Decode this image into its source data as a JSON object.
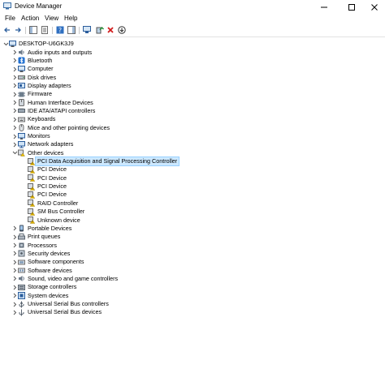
{
  "window": {
    "title": "Device Manager"
  },
  "menu": [
    "File",
    "Action",
    "View",
    "Help"
  ],
  "tree": {
    "root": "DESKTOP-U6GK3J9",
    "categories_before": [
      {
        "label": "Audio inputs and outputs",
        "icon": "speaker-icon"
      },
      {
        "label": "Bluetooth",
        "icon": "bluetooth-icon"
      },
      {
        "label": "Computer",
        "icon": "computer-icon"
      },
      {
        "label": "Disk drives",
        "icon": "disk-drive-icon"
      },
      {
        "label": "Display adapters",
        "icon": "display-adapter-icon"
      },
      {
        "label": "Firmware",
        "icon": "firmware-icon"
      },
      {
        "label": "Human Interface Devices",
        "icon": "hid-icon"
      },
      {
        "label": "IDE ATA/ATAPI controllers",
        "icon": "ide-controller-icon"
      },
      {
        "label": "Keyboards",
        "icon": "keyboard-icon"
      },
      {
        "label": "Mice and other pointing devices",
        "icon": "mouse-icon"
      },
      {
        "label": "Monitors",
        "icon": "monitor-icon"
      },
      {
        "label": "Network adapters",
        "icon": "network-adapter-icon"
      }
    ],
    "other_devices": {
      "label": "Other devices",
      "children": [
        "PCI Data Acquisition and Signal Processing Controller",
        "PCI Device",
        "PCI Device",
        "PCI Device",
        "PCI Device",
        "RAID Controller",
        "SM Bus Controller",
        "Unknown device"
      ],
      "selected_index": 0
    },
    "categories_after": [
      {
        "label": "Portable Devices",
        "icon": "portable-device-icon"
      },
      {
        "label": "Print queues",
        "icon": "printer-icon"
      },
      {
        "label": "Processors",
        "icon": "processor-icon"
      },
      {
        "label": "Security devices",
        "icon": "security-device-icon"
      },
      {
        "label": "Software components",
        "icon": "software-component-icon"
      },
      {
        "label": "Software devices",
        "icon": "software-device-icon"
      },
      {
        "label": "Sound, video and game controllers",
        "icon": "sound-icon"
      },
      {
        "label": "Storage controllers",
        "icon": "storage-controller-icon"
      },
      {
        "label": "System devices",
        "icon": "system-device-icon"
      },
      {
        "label": "Universal Serial Bus controllers",
        "icon": "usb-controller-icon"
      },
      {
        "label": "Universal Serial Bus devices",
        "icon": "usb-device-icon"
      }
    ]
  },
  "colors": {
    "selection": "#cce8ff",
    "selection_border": "#99d1ff",
    "remove": "#d11a1a",
    "update": "#1e8a2e"
  }
}
